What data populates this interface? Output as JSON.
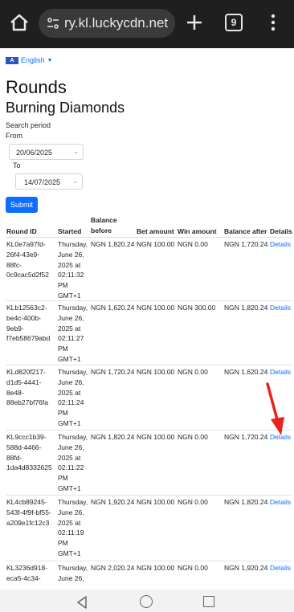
{
  "browser": {
    "url": "ry.kl.luckycdn.net",
    "tab_count": "9",
    "colors": {
      "bar": "#1f1f1f",
      "url_bg": "#3a3a3a"
    }
  },
  "language": {
    "label": "English",
    "flag": "A"
  },
  "page": {
    "title": "Rounds",
    "game": "Burning Diamonds",
    "search_period_label": "Search period",
    "from_label": "From",
    "from_value": "20/06/2025",
    "to_label": "To",
    "to_value": "14/07/2025",
    "submit_label": "Submit"
  },
  "table": {
    "headers": {
      "round_id": "Round ID",
      "started": "Started",
      "balance_before": "Balance before",
      "bet_amount": "Bet amount",
      "win_amount": "Win amount",
      "balance_after": "Balance after",
      "details": "Details"
    },
    "rows": [
      {
        "id_lines": [
          "KL0e7a97fd-",
          "26f4-43e9-",
          "88fc-",
          "0c9cac5d2f52"
        ],
        "started_lines": [
          "Thursday,",
          "June 26,",
          "2025 at",
          "02:11:32",
          "PM",
          "GMT+1"
        ],
        "balance_before": "NGN 1,820.24",
        "bet": "NGN 100.00",
        "win": "NGN 0.00",
        "balance_after": "NGN 1,720.24",
        "details": "Details"
      },
      {
        "id_lines": [
          "KLb12563c2-",
          "be4c-400b-",
          "9eb9-",
          "f7eb58679abd"
        ],
        "started_lines": [
          "Thursday,",
          "June 26,",
          "2025 at",
          "02:11:27",
          "PM",
          "GMT+1"
        ],
        "balance_before": "NGN 1,620.24",
        "bet": "NGN 100.00",
        "win": "NGN 300.00",
        "balance_after": "NGN 1,820.24",
        "details": "Details"
      },
      {
        "id_lines": [
          "KLd820f217-",
          "d1d5-4441-",
          "8e48-",
          "88eb27bf76fa"
        ],
        "started_lines": [
          "Thursday,",
          "June 26,",
          "2025 at",
          "02:11:24",
          "PM",
          "GMT+1"
        ],
        "balance_before": "NGN 1,720.24",
        "bet": "NGN 100.00",
        "win": "NGN 0.00",
        "balance_after": "NGN 1,620.24",
        "details": "Details"
      },
      {
        "id_lines": [
          "KL9ccc1b39-",
          "588d-4466-",
          "88fd-",
          "1da4d8332625"
        ],
        "started_lines": [
          "Thursday,",
          "June 26,",
          "2025 at",
          "02:11:22",
          "PM",
          "GMT+1"
        ],
        "balance_before": "NGN 1,820.24",
        "bet": "NGN 100.00",
        "win": "NGN 0.00",
        "balance_after": "NGN 1,720.24",
        "details": "Details"
      },
      {
        "id_lines": [
          "KL4cb89245-",
          "543f-4f9f-bf55-",
          "a209e1fc12c3"
        ],
        "started_lines": [
          "Thursday,",
          "June 26,",
          "2025 at",
          "02:11:19",
          "PM",
          "GMT+1"
        ],
        "balance_before": "NGN 1,920.24",
        "bet": "NGN 100.00",
        "win": "NGN 0.00",
        "balance_after": "NGN 1,820.24",
        "details": "Details"
      },
      {
        "id_lines": [
          "KL3236d918-",
          "eca5-4c34-"
        ],
        "started_lines": [
          "Thursday,",
          "June 26,"
        ],
        "balance_before": "NGN 2,020.24",
        "bet": "NGN 100.00",
        "win": "NGN 0.00",
        "balance_after": "NGN 1,920.24",
        "details": "Details"
      }
    ]
  },
  "annotation": {
    "arrow_color": "#e8231c"
  }
}
